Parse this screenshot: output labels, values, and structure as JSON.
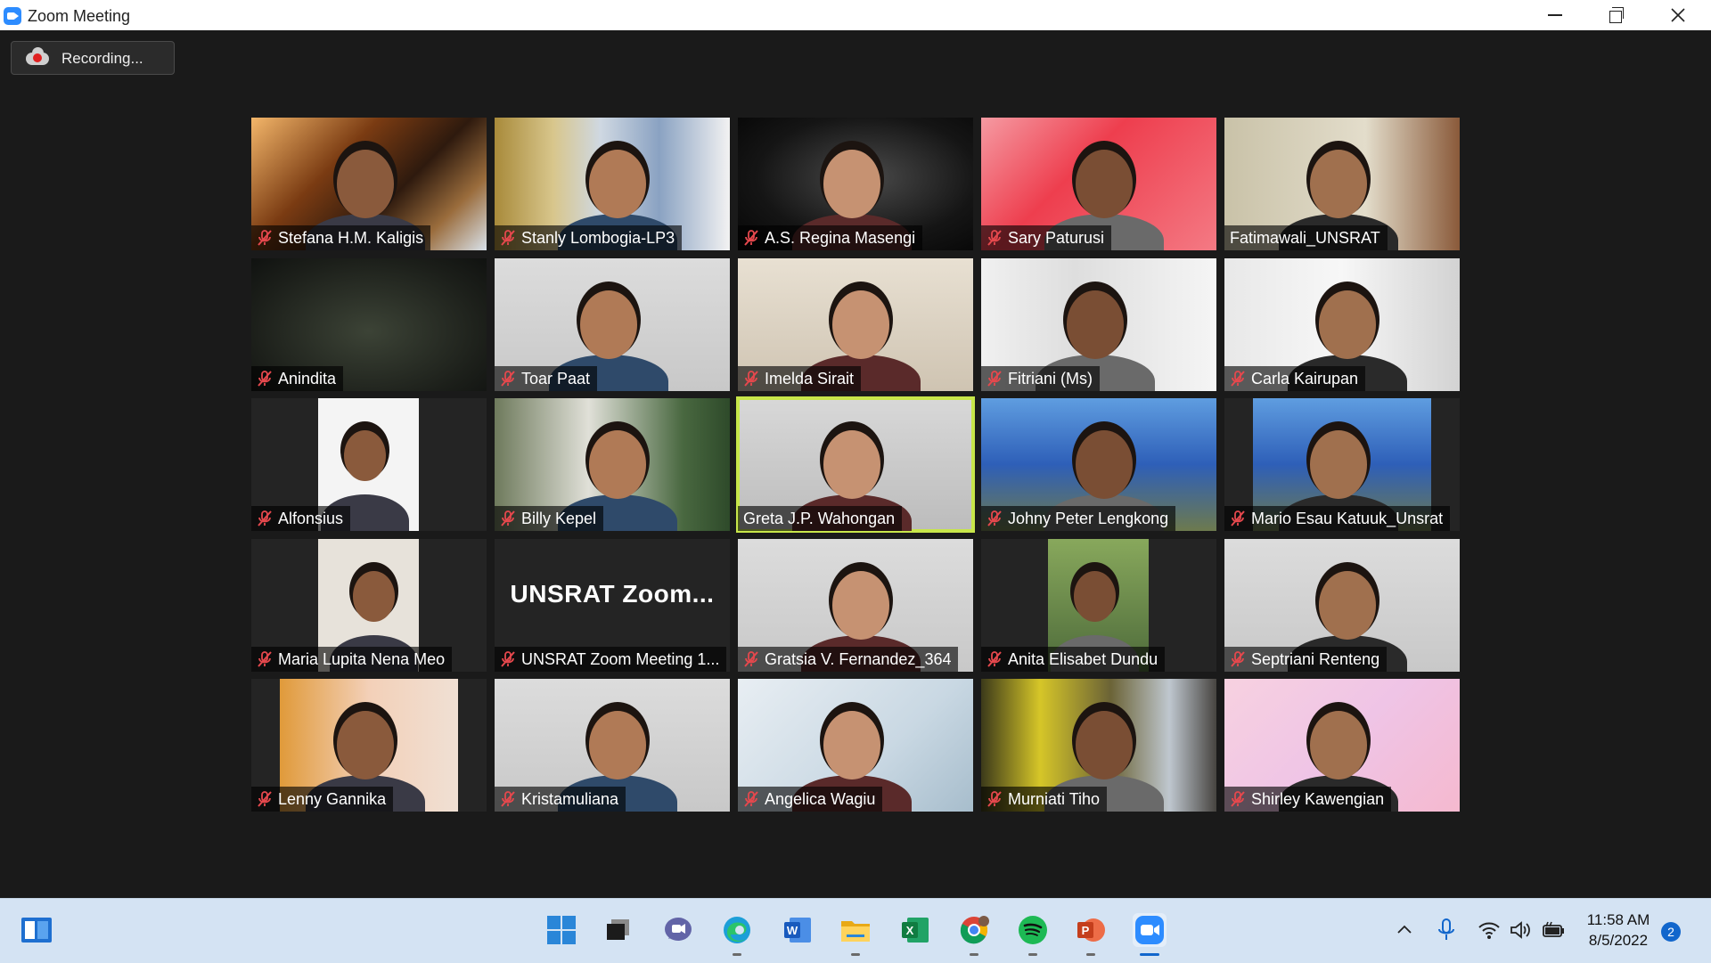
{
  "window": {
    "title": "Zoom Meeting"
  },
  "recording": {
    "label": "Recording..."
  },
  "participants": [
    {
      "name": "Stefana H.M. Kaligis",
      "muted": true,
      "background": "autumn"
    },
    {
      "name": "Stanly Lombogia-LP3",
      "muted": true,
      "background": "campus"
    },
    {
      "name": "A.S. Regina Masengi",
      "muted": true,
      "background": "dark"
    },
    {
      "name": "Sary Paturusi",
      "muted": true,
      "background": "red"
    },
    {
      "name": "Fatimawali_UNSRAT",
      "muted": false,
      "background": "beige"
    },
    {
      "name": "Anindita",
      "muted": true,
      "background": "blur"
    },
    {
      "name": "Toar Paat",
      "muted": true,
      "background": "lightgray"
    },
    {
      "name": "Imelda Sirait",
      "muted": true,
      "background": "cream"
    },
    {
      "name": "Fitriani (Ms)",
      "muted": true,
      "background": "room"
    },
    {
      "name": "Carla Kairupan",
      "muted": true,
      "background": "kitchen"
    },
    {
      "name": "Alfonsius",
      "muted": true,
      "background": "white-portrait"
    },
    {
      "name": "Billy Kepel",
      "muted": true,
      "background": "building"
    },
    {
      "name": "Greta J.P. Wahongan",
      "muted": false,
      "background": "wall",
      "active_speaker": true
    },
    {
      "name": "Johny Peter Lengkong",
      "muted": true,
      "background": "blue-building"
    },
    {
      "name": "Mario Esau Katuuk_Unsrat",
      "muted": true,
      "background": "blue-building-portrait"
    },
    {
      "name": "Maria Lupita Nena Meo",
      "muted": true,
      "background": "portrait"
    },
    {
      "name": "UNSRAT Zoom Meeting 1...",
      "muted": true,
      "background": "text",
      "tile_text": "UNSRAT  Zoom..."
    },
    {
      "name": "Gratsia V. Fernandez_364",
      "muted": true,
      "background": "lightgray"
    },
    {
      "name": "Anita Elisabet Dundu",
      "muted": true,
      "background": "trees-portrait"
    },
    {
      "name": "Septriani Renteng",
      "muted": true,
      "background": "lightgray"
    },
    {
      "name": "Lenny Gannika",
      "muted": true,
      "background": "doorroom-portrait"
    },
    {
      "name": "Kristamuliana",
      "muted": true,
      "background": "lightgray"
    },
    {
      "name": "Angelica Wagiu",
      "muted": true,
      "background": "bss"
    },
    {
      "name": "Murniati Tiho",
      "muted": true,
      "background": "curtain"
    },
    {
      "name": "Shirley Kawengian",
      "muted": true,
      "background": "pink"
    }
  ],
  "taskbar": {
    "apps": [
      {
        "name": "start",
        "running": false
      },
      {
        "name": "task-view",
        "running": false
      },
      {
        "name": "teams-chat",
        "running": false
      },
      {
        "name": "edge",
        "running": true
      },
      {
        "name": "word",
        "running": false
      },
      {
        "name": "file-explorer",
        "running": true
      },
      {
        "name": "excel",
        "running": false
      },
      {
        "name": "chrome",
        "running": true
      },
      {
        "name": "spotify",
        "running": true
      },
      {
        "name": "powerpoint",
        "running": true
      },
      {
        "name": "zoom",
        "running": true,
        "active": true
      }
    ],
    "clock": {
      "time": "11:58 AM",
      "date": "8/5/2022"
    },
    "notifications": "2"
  },
  "colors": {
    "mute_red": "#e5484d",
    "active_speaker": "#c8e64a",
    "zoom_blue": "#2D8CFF",
    "taskbar_bg": "#d4e3f3"
  }
}
